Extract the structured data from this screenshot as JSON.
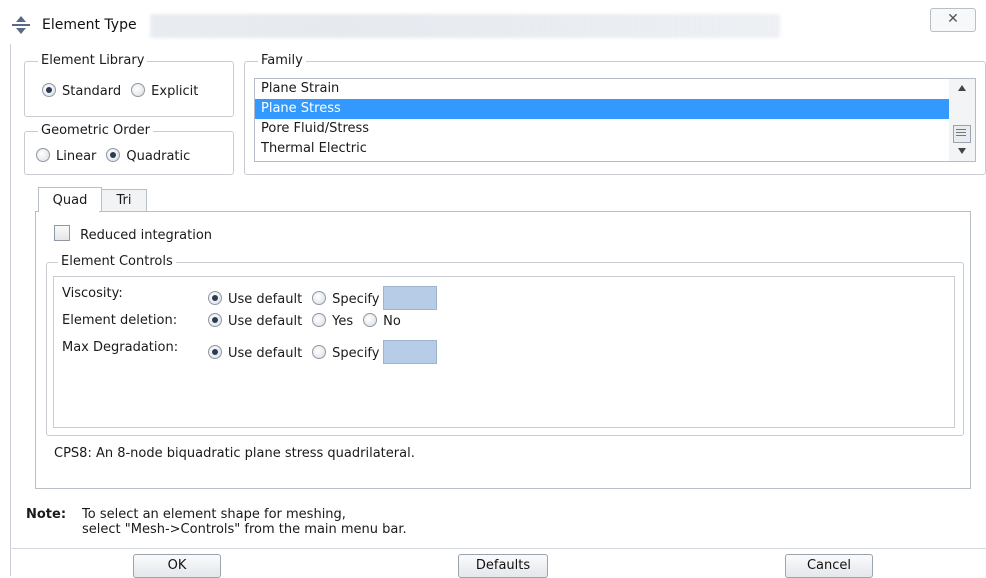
{
  "window": {
    "title": "Element Type",
    "close_glyph": "✕"
  },
  "element_library": {
    "title": "Element Library",
    "options": [
      "Standard",
      "Explicit"
    ],
    "selected": "Standard"
  },
  "geometric_order": {
    "title": "Geometric Order",
    "options": [
      "Linear",
      "Quadratic"
    ],
    "selected": "Quadratic"
  },
  "family": {
    "title": "Family",
    "items": [
      "Plane Strain",
      "Plane Stress",
      "Pore Fluid/Stress",
      "Thermal Electric"
    ],
    "selected": "Plane Stress"
  },
  "tabs": [
    {
      "label": "Quad",
      "active": true
    },
    {
      "label": "Tri",
      "active": false
    }
  ],
  "quad": {
    "reduced_integration_label": "Reduced integration",
    "reduced_integration_checked": false,
    "element_controls": {
      "title": "Element Controls",
      "rows": [
        {
          "label": "Viscosity:",
          "options": [
            "Use default",
            "Specify"
          ],
          "selected": "Use default",
          "has_field": true
        },
        {
          "label": "Element deletion:",
          "options": [
            "Use default",
            "Yes",
            "No"
          ],
          "selected": "Use default",
          "has_field": false
        },
        {
          "label": "Max Degradation:",
          "options": [
            "Use default",
            "Specify"
          ],
          "selected": "Use default",
          "has_field": true
        }
      ]
    },
    "description": "CPS8:  An 8-node biquadratic plane stress quadrilateral."
  },
  "note": {
    "label": "Note:",
    "line1": "To select an element shape for meshing,",
    "line2": "select \"Mesh->Controls\" from the main menu bar."
  },
  "buttons": {
    "ok": "OK",
    "defaults": "Defaults",
    "cancel": "Cancel"
  },
  "colors": {
    "selection": "#3399ff",
    "field": "#b7cce6"
  }
}
